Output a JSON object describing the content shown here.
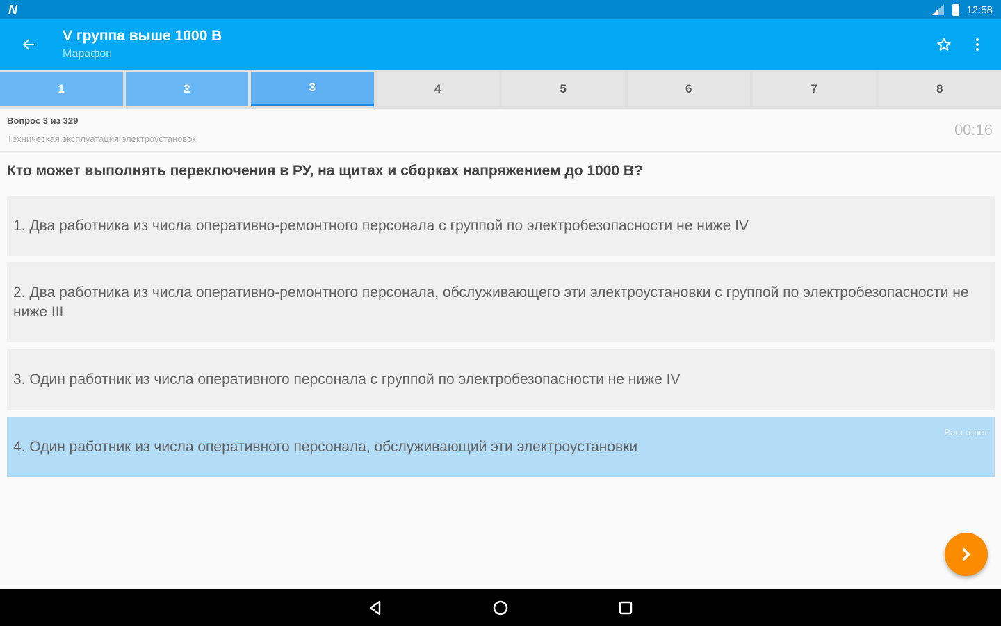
{
  "status": {
    "time": "12:58",
    "logo": "N"
  },
  "app_bar": {
    "title": "V группа выше 1000 В",
    "subtitle": "Марафон",
    "icons": [
      "arrow-back-icon",
      "star-outline-icon",
      "more-vert-icon"
    ]
  },
  "tabs": [
    {
      "label": "1"
    },
    {
      "label": "2"
    },
    {
      "label": "3"
    },
    {
      "label": "4"
    },
    {
      "label": "5"
    },
    {
      "label": "6"
    },
    {
      "label": "7"
    },
    {
      "label": "8"
    }
  ],
  "question": {
    "counter": "Вопрос 3 из 329",
    "category": "Техническая эксплуатация электроустановок",
    "timer": "00:16",
    "text": "Кто может выполнять переключения в РУ, на щитах и сборках напряжением до 1000 В?"
  },
  "answers": [
    {
      "text": "1. Два работника из числа оперативно-ремонтного персонала с группой по электробезопасности не ниже IV"
    },
    {
      "text": "2. Два работника из числа оперативно-ремонтного персонала, обслуживающего эти электроустановки с группой по электробезопасности не ниже III"
    },
    {
      "text": "3. Один работник из числа оперативного персонала с группой по электробезопасности не ниже IV"
    },
    {
      "text": "4. Один работник из числа оперативного персонала, обслуживающий эти электроустановки",
      "tag": "Ваш ответ"
    }
  ],
  "colors": {
    "status": "#0288d1",
    "primary": "#03a9f4",
    "accent": "#fb8c00",
    "selected": "#b3dcf7"
  }
}
